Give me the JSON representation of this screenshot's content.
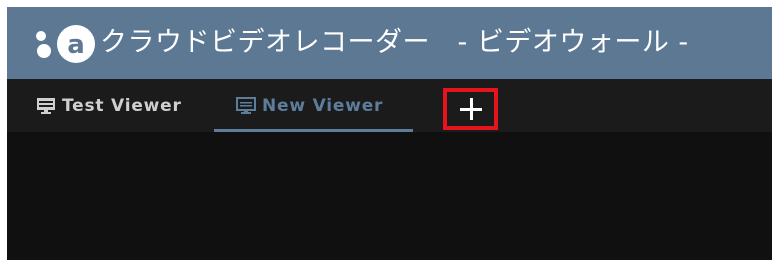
{
  "window": {
    "title": "クラウドビデオレコーダー　- ビデオウォール -",
    "logo_icon": "app-logo-icon",
    "title_bar_color": "#5c7893"
  },
  "tabs": [
    {
      "label": "Test Viewer",
      "icon": "monitor-icon",
      "active": false
    },
    {
      "label": "New Viewer",
      "icon": "monitor-icon",
      "active": true
    }
  ],
  "add_tab": {
    "icon": "plus-icon",
    "highlight_color": "#e8141d"
  },
  "colors": {
    "active_tab": "#5e7d9b",
    "inactive_tab": "#cfcfcf",
    "background": "#101010"
  }
}
